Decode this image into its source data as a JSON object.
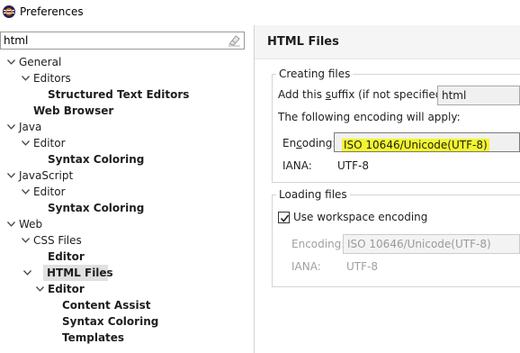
{
  "window": {
    "title": "Preferences"
  },
  "filter": {
    "value": "html"
  },
  "tree": [
    {
      "label": "General",
      "level": 0,
      "expanded": true,
      "bold": false
    },
    {
      "label": "Editors",
      "level": 1,
      "expanded": true,
      "bold": false
    },
    {
      "label": "Structured Text Editors",
      "level": 2,
      "expanded": null,
      "bold": true
    },
    {
      "label": "Web Browser",
      "level": 1,
      "expanded": null,
      "bold": true
    },
    {
      "label": "Java",
      "level": 0,
      "expanded": true,
      "bold": false
    },
    {
      "label": "Editor",
      "level": 1,
      "expanded": true,
      "bold": false
    },
    {
      "label": "Syntax Coloring",
      "level": 2,
      "expanded": null,
      "bold": true
    },
    {
      "label": "JavaScript",
      "level": 0,
      "expanded": true,
      "bold": false
    },
    {
      "label": "Editor",
      "level": 1,
      "expanded": true,
      "bold": false
    },
    {
      "label": "Syntax Coloring",
      "level": 2,
      "expanded": null,
      "bold": true
    },
    {
      "label": "Web",
      "level": 0,
      "expanded": true,
      "bold": false
    },
    {
      "label": "CSS Files",
      "level": 1,
      "expanded": true,
      "bold": false
    },
    {
      "label": "Editor",
      "level": 2,
      "expanded": null,
      "bold": true
    },
    {
      "label": "HTML Files",
      "level": 1,
      "expanded": true,
      "bold": true,
      "selected": true
    },
    {
      "label": "Editor",
      "level": 2,
      "expanded": true,
      "bold": true
    },
    {
      "label": "Content Assist",
      "level": 3,
      "expanded": null,
      "bold": true
    },
    {
      "label": "Syntax Coloring",
      "level": 3,
      "expanded": null,
      "bold": true
    },
    {
      "label": "Templates",
      "level": 3,
      "expanded": null,
      "bold": true
    }
  ],
  "page": {
    "title": "HTML Files",
    "creating": {
      "group_title": "Creating files",
      "suffix_label_pre": "Add this ",
      "suffix_label_mnemonic": "s",
      "suffix_label_post": "uffix (if not specified):",
      "suffix_value": "html",
      "encoding_note": "The following encoding will apply:",
      "encoding_label_pre": "En",
      "encoding_label_mnemonic": "c",
      "encoding_label_post": "oding:",
      "encoding_value": "ISO 10646/Unicode(UTF-8)",
      "iana_label": "IANA:",
      "iana_value": "UTF-8"
    },
    "loading": {
      "group_title": "Loading files",
      "use_workspace_label": "Use workspace encoding",
      "use_workspace_checked": true,
      "encoding_label": "Encoding:",
      "encoding_value": "ISO 10646/Unicode(UTF-8)",
      "iana_label": "IANA:",
      "iana_value": "UTF-8"
    }
  },
  "colors": {
    "highlight": "#f3f62c",
    "selection": "#e0e0e0"
  }
}
